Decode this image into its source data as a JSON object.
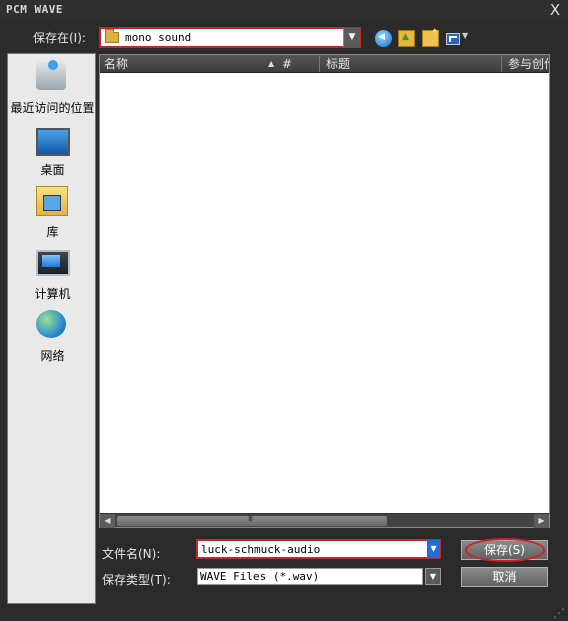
{
  "window": {
    "title": "PCM WAVE",
    "close": "X"
  },
  "lookin": {
    "label": "保存在(I):",
    "value": "mono sound"
  },
  "toolbar": {
    "icons": [
      "back-icon",
      "up-folder-icon",
      "new-folder-icon",
      "view-menu-icon"
    ]
  },
  "places": [
    {
      "label": "最近访问的位置",
      "icon": "recent-places-icon"
    },
    {
      "label": "桌面",
      "icon": "desktop-icon"
    },
    {
      "label": "库",
      "icon": "library-icon"
    },
    {
      "label": "计算机",
      "icon": "computer-icon"
    },
    {
      "label": "网络",
      "icon": "network-icon"
    }
  ],
  "list": {
    "columns": [
      "名称",
      "#",
      "标题",
      "参与创作"
    ],
    "sort_indicator": "▲",
    "scroll_grip": "III"
  },
  "filename": {
    "label": "文件名(N):",
    "value": "luck-schmuck-audio"
  },
  "filetype": {
    "label": "保存类型(T):",
    "value": "WAVE Files (*.wav)"
  },
  "buttons": {
    "save": "保存(S)",
    "cancel": "取消"
  },
  "colors": {
    "highlight": "#d0202a",
    "accent": "#1f6fd8"
  }
}
